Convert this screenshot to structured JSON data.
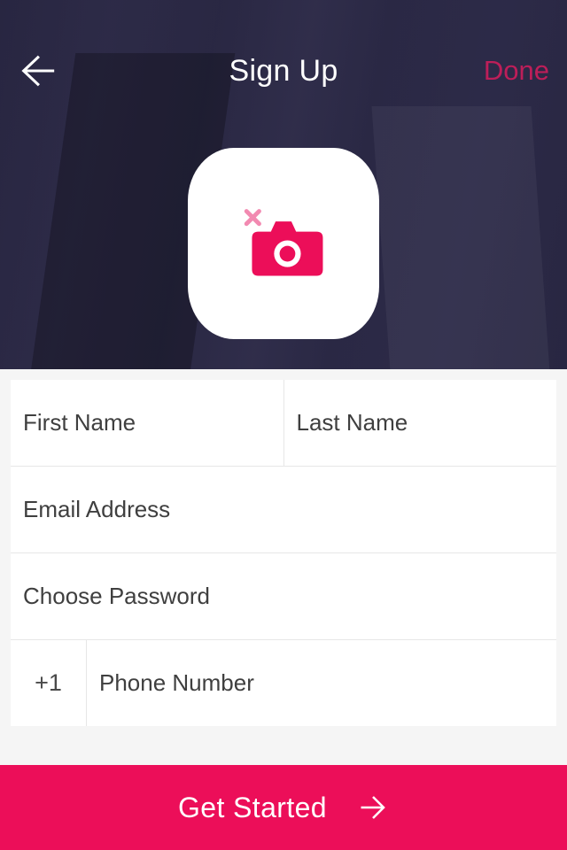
{
  "colors": {
    "accent": "#ec0e59",
    "done": "#bd1e59",
    "headerBg": "#2c2a45"
  },
  "header": {
    "title": "Sign Up",
    "done_label": "Done"
  },
  "avatar": {
    "icon_name": "camera-icon"
  },
  "form": {
    "first_name": {
      "placeholder": "First Name",
      "value": ""
    },
    "last_name": {
      "placeholder": "Last Name",
      "value": ""
    },
    "email": {
      "placeholder": "Email Address",
      "value": ""
    },
    "password": {
      "placeholder": "Choose Password",
      "value": ""
    },
    "phone_prefix": "+1",
    "phone": {
      "placeholder": "Phone Number",
      "value": ""
    }
  },
  "cta": {
    "label": "Get Started"
  }
}
